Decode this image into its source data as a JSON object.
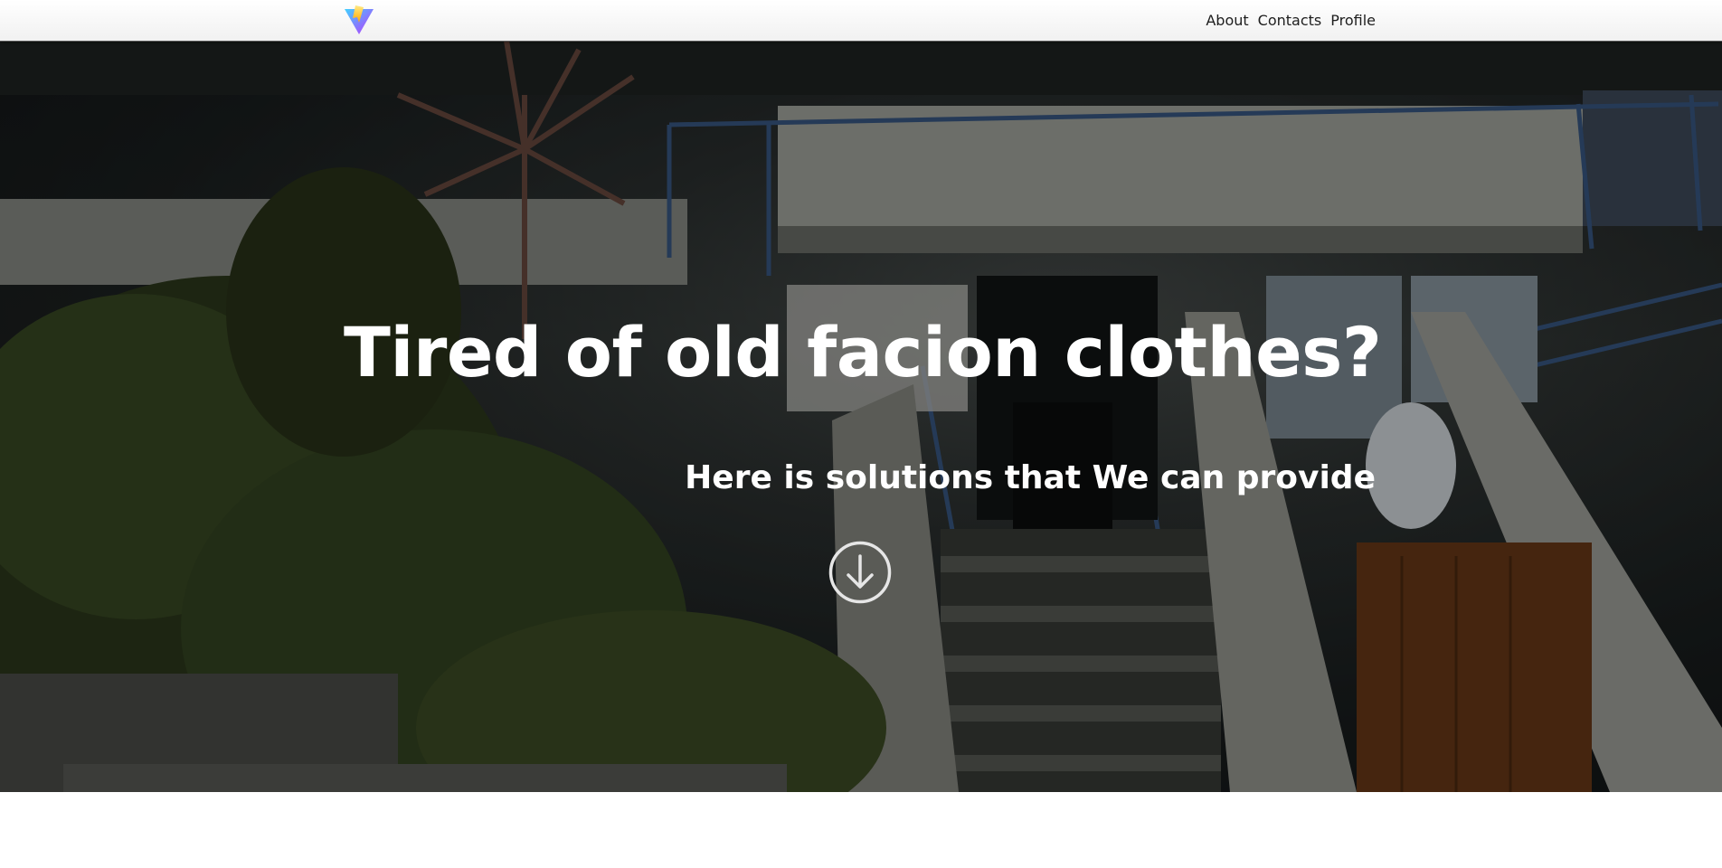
{
  "header": {
    "logo_icon": "vite-logo-icon",
    "nav": {
      "about": "About",
      "contacts": "Contacts",
      "profile": "Profile"
    }
  },
  "hero": {
    "title": "Tired of old facion clothes?",
    "subtitle": "Here is solutions that We can provide",
    "scroll_icon": "arrow-down-circle-icon",
    "background": "photo-apartment-building-exterior"
  },
  "colors": {
    "logo_purple": "#8c6cf6",
    "logo_yellow": "#ffcc33",
    "text_white": "#ffffff",
    "nav_text": "#1e1e1e"
  }
}
